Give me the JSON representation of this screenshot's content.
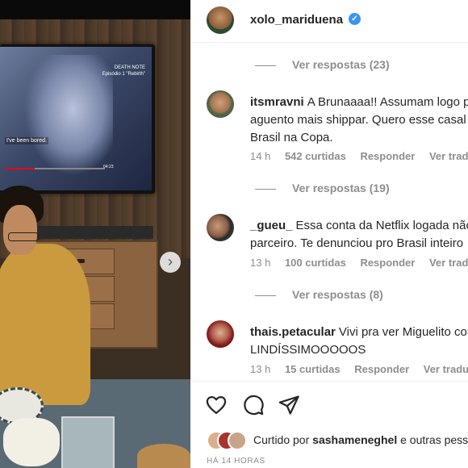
{
  "post": {
    "author": "xolo_mariduena",
    "verified": "✓"
  },
  "photo": {
    "tv_title": "DEATH NOTE",
    "tv_episode": "Episódio 1 \"Rebirth\"",
    "tv_subtitle": "I've been bored.",
    "tv_time": "04:23",
    "nav_arrow": "›"
  },
  "replies": [
    {
      "label": "Ver respostas (23)"
    },
    {
      "label": "Ver respostas (19)"
    },
    {
      "label": "Ver respostas (8)"
    }
  ],
  "comments": [
    {
      "username": "itsmravni",
      "line1": "A Brunaaaa!! Assumam logo porque não",
      "line2": "aguento mais shippar. Quero esse casal no",
      "line3": "Brasil na Copa.",
      "time": "14 h",
      "likes": "542 curtidas",
      "reply": "Responder",
      "translate": "Ver tradução"
    },
    {
      "username": "_gueu_",
      "line1": "Essa conta da Netflix logada não",
      "line2": "parceiro. Te denunciou pro Brasil inteiro",
      "time": "13 h",
      "likes": "100 curtidas",
      "reply": "Responder",
      "translate": "Ver tradução"
    },
    {
      "username": "thais.petacular",
      "line1": "Vivi pra ver Miguelito com a Bruna",
      "line2": "LINDÍSSIMOOOOOS",
      "time": "13 h",
      "likes": "15 curtidas",
      "reply": "Responder",
      "translate": "Ver tradução"
    }
  ],
  "actions": {
    "like_icon": "heart-icon",
    "comment_icon": "comment-icon",
    "share_icon": "send-icon"
  },
  "liked_by": {
    "prefix": "Curtido por",
    "user": "sashameneghel",
    "suffix": "e outras pessoas"
  },
  "timestamp": "HÁ 14 HORAS",
  "colors": {
    "verified": "#3897f0",
    "muted": "#8e8e8e",
    "text": "#262626"
  }
}
